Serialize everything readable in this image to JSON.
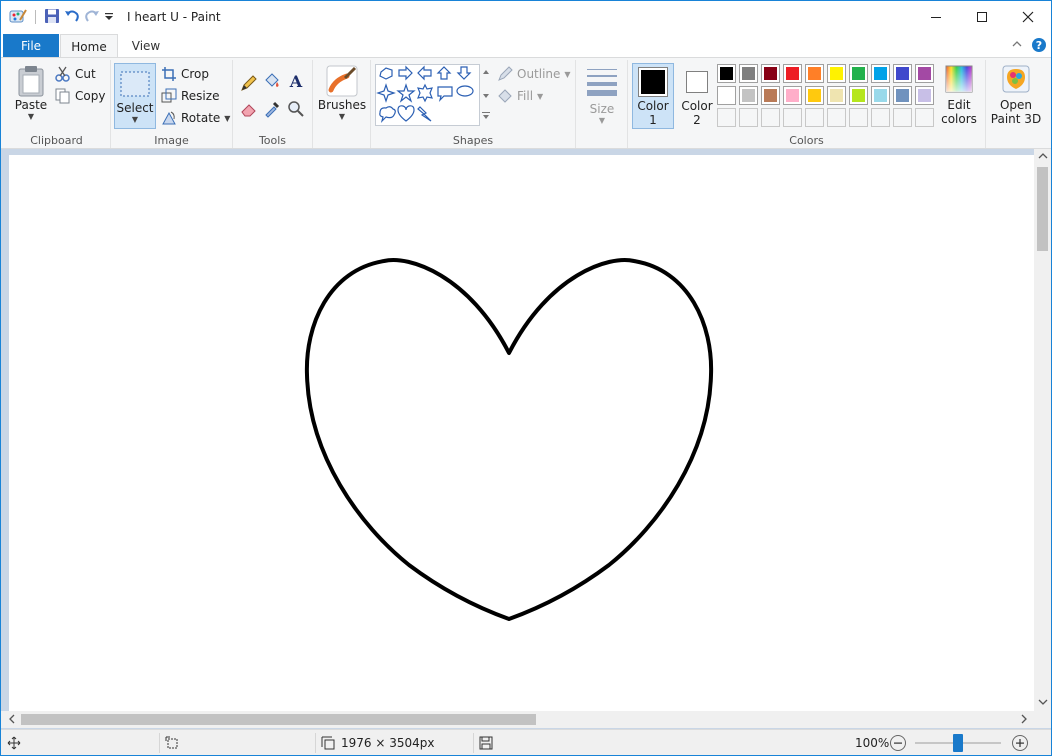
{
  "window": {
    "title": "I heart U - Paint"
  },
  "tabs": {
    "file": "File",
    "home": "Home",
    "view": "View"
  },
  "clipboard": {
    "paste": "Paste",
    "cut": "Cut",
    "copy": "Copy",
    "label": "Clipboard"
  },
  "image": {
    "select": "Select",
    "crop": "Crop",
    "resize": "Resize",
    "rotate": "Rotate",
    "label": "Image"
  },
  "tools": {
    "label": "Tools"
  },
  "brushes": {
    "label": "Brushes"
  },
  "shapes": {
    "outline": "Outline",
    "fill": "Fill",
    "label": "Shapes"
  },
  "size": {
    "label": "Size"
  },
  "colors": {
    "color1_label": "Color",
    "color1_num": "1",
    "color2_label": "Color",
    "color2_num": "2",
    "color1_value": "#000000",
    "color2_value": "#ffffff",
    "edit_label_1": "Edit",
    "edit_label_2": "colors",
    "label": "Colors",
    "palette_row1": [
      "#000000",
      "#7f7f7f",
      "#880015",
      "#ed1c24",
      "#ff7f27",
      "#fff200",
      "#22b14c",
      "#00a2e8",
      "#3f48cc",
      "#a349a4"
    ],
    "palette_row2": [
      "#ffffff",
      "#c3c3c3",
      "#b97a57",
      "#ffaec9",
      "#ffc90e",
      "#efe4b0",
      "#b5e61d",
      "#99d9ea",
      "#7092be",
      "#c8bfe7"
    ]
  },
  "paint3d": {
    "line1": "Open",
    "line2": "Paint 3D"
  },
  "status": {
    "dimensions": "1976 × 3504px",
    "zoom": "100%"
  }
}
